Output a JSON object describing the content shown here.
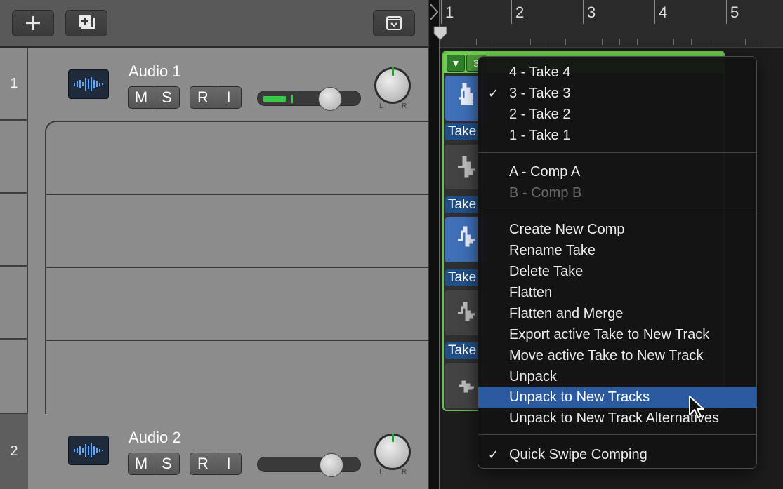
{
  "toolbar": {
    "add_icon": "plus-icon",
    "duplicate_icon": "duplicate-track-icon",
    "inspector_icon": "dropdown-panel-icon"
  },
  "tracks": [
    {
      "number": "1",
      "name": "Audio 1",
      "buttons": [
        "M",
        "S"
      ],
      "buttons2": [
        "R",
        "I"
      ],
      "pan_l": "L",
      "pan_r": "R",
      "meter_active": true
    },
    {
      "number": "2",
      "name": "Audio 2",
      "buttons": [
        "M",
        "S"
      ],
      "buttons2": [
        "R",
        "I"
      ],
      "pan_l": "L",
      "pan_r": "R",
      "meter_active": false
    }
  ],
  "ruler": {
    "bars": [
      "1",
      "2",
      "3",
      "4",
      "5"
    ]
  },
  "take_folder": {
    "header_text": "3",
    "lanes": [
      {
        "label": "",
        "style": "blue"
      },
      {
        "label": "Take",
        "style": "grey"
      },
      {
        "label": "Take",
        "style": "blue"
      },
      {
        "label": "Take",
        "style": "grey"
      },
      {
        "label": "Take",
        "style": "grey"
      }
    ]
  },
  "menu": {
    "groups": [
      [
        {
          "label": "4 - Take 4",
          "checked": false,
          "disabled": false
        },
        {
          "label": "3 - Take 3",
          "checked": true,
          "disabled": false
        },
        {
          "label": "2 - Take 2",
          "checked": false,
          "disabled": false
        },
        {
          "label": "1 - Take 1",
          "checked": false,
          "disabled": false
        }
      ],
      [
        {
          "label": "A - Comp A",
          "checked": false,
          "disabled": false
        },
        {
          "label": "B - Comp B",
          "checked": false,
          "disabled": true
        }
      ],
      [
        {
          "label": "Create New Comp",
          "checked": false,
          "disabled": false
        },
        {
          "label": "Rename Take",
          "checked": false,
          "disabled": false
        },
        {
          "label": "Delete Take",
          "checked": false,
          "disabled": false
        },
        {
          "label": "Flatten",
          "checked": false,
          "disabled": false
        },
        {
          "label": "Flatten and Merge",
          "checked": false,
          "disabled": false
        },
        {
          "label": "Export active Take to New Track",
          "checked": false,
          "disabled": false
        },
        {
          "label": "Move active Take to New Track",
          "checked": false,
          "disabled": false
        },
        {
          "label": "Unpack",
          "checked": false,
          "disabled": false
        },
        {
          "label": "Unpack to New Tracks",
          "checked": false,
          "disabled": false,
          "selected": true
        },
        {
          "label": "Unpack to New Track Alternatives",
          "checked": false,
          "disabled": false
        }
      ],
      [
        {
          "label": "Quick Swipe Comping",
          "checked": true,
          "disabled": false
        }
      ]
    ],
    "check_glyph": "✓"
  },
  "colors": {
    "accent_green": "#6fcf4e",
    "menu_highlight": "#2b5aa0",
    "take_blue": "#3f6fb7"
  }
}
